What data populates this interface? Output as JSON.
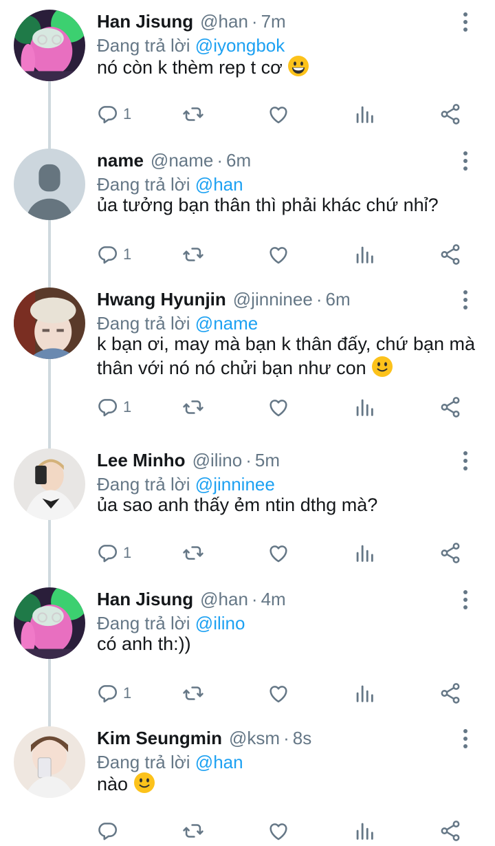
{
  "tweets": [
    {
      "name": "Han Jisung",
      "handle": "@han",
      "time": "7m",
      "reply_prefix": "Đang trả lời",
      "reply_to": "@iyongbok",
      "text": "nó còn k thèm rep t cơ",
      "emoji": "grinning-emoji",
      "reply_count": "1",
      "avatar": "photo-pink-green"
    },
    {
      "name": "name",
      "handle": "@name",
      "time": "6m",
      "reply_prefix": "Đang trả lời",
      "reply_to": "@han",
      "text": "ủa tưởng bạn thân thì phải khác chứ nhỉ?",
      "emoji": "",
      "reply_count": "1",
      "avatar": "default-silhouette"
    },
    {
      "name": "Hwang Hyunjin",
      "handle": "@jinninee",
      "time": "6m",
      "reply_prefix": "Đang trả lời",
      "reply_to": "@name",
      "text": "k bạn ơi, may mà bạn k thân đấy, chứ bạn mà thân với nó nó chửi bạn như con",
      "emoji": "slight-smile-emoji",
      "reply_count": "1",
      "avatar": "photo-beanie"
    },
    {
      "name": "Lee Minho",
      "handle": "@ilino",
      "time": "5m",
      "reply_prefix": "Đang trả lời",
      "reply_to": "@jinninee",
      "text": "ủa sao anh thấy ẻm ntin dthg mà?",
      "emoji": "",
      "reply_count": "1",
      "avatar": "photo-mirror-selfie"
    },
    {
      "name": "Han Jisung",
      "handle": "@han",
      "time": "4m",
      "reply_prefix": "Đang trả lời",
      "reply_to": "@ilino",
      "text": "có anh th:))",
      "emoji": "",
      "reply_count": "1",
      "avatar": "photo-pink-green"
    },
    {
      "name": "Kim Seungmin",
      "handle": "@ksm",
      "time": "8s",
      "reply_prefix": "Đang trả lời",
      "reply_to": "@han",
      "text": "nào",
      "emoji": "slight-smile-emoji",
      "reply_count": "",
      "avatar": "photo-phone-selfie"
    }
  ],
  "icons": {
    "reply": "reply-icon",
    "retweet": "retweet-icon",
    "like": "heart-icon",
    "analytics": "analytics-icon",
    "share": "share-icon",
    "more": "more-vertical-icon"
  },
  "colors": {
    "accent": "#1da1f2",
    "secondary_text": "#657786",
    "primary_text": "#14171a",
    "thread_line": "#cfd9de"
  }
}
